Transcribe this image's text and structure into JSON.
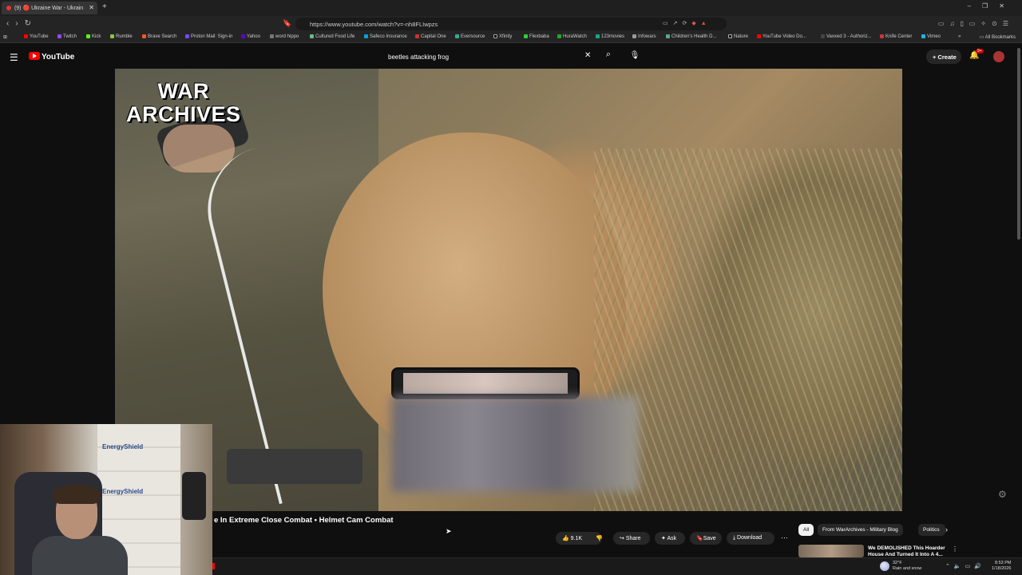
{
  "browser": {
    "tab_title": "(9) 🔴 Ukraine War - Ukrain",
    "url": "https://www.youtube.com/watch?v=-nh8FLIwpzs",
    "bookmarks": [
      "YouTube",
      "Twitch",
      "Kick",
      "Rumble",
      "Brave Search",
      "Proton Mail: Sign-in",
      "Yahoo",
      "word hippo",
      "Cultured Food Life",
      "Safeco Insurance",
      "Capital One",
      "Eversource",
      "Xfinity",
      "Flexbaba",
      "HuraWatch",
      "123movies",
      "Infowars",
      "Children's Health D...",
      "Nature",
      "YouTube Video Do...",
      "Vaxxed 3 - Authoriz...",
      "Knife Center",
      "Vimeo"
    ],
    "all_bookmarks": "All Bookmarks"
  },
  "youtube": {
    "logo": "YouTube",
    "search_query": "beetles attacking frog",
    "create_label": "Create",
    "notif_badge": "9+"
  },
  "video": {
    "watermark_line1": "WAR",
    "watermark_line2": "ARCHIVES",
    "title": "e In Extreme Close Combat • Helmet Cam Combat"
  },
  "webcam": {
    "label1": "EnergyShield",
    "label2": "EnergyShield"
  },
  "actions": {
    "likes": "9.1K",
    "share": "Share",
    "ask": "Ask",
    "save": "Save",
    "download": "Download"
  },
  "chips": [
    "All",
    "From WarArchives - Military Blog",
    "Politics"
  ],
  "recommendation": {
    "title": "We DEMOLISHED This Hoarder House And Turned It Into A 4..."
  },
  "taskbar": {
    "temperature": "32°F",
    "weather_desc": "Rain and snow",
    "time": "8:53 PM",
    "date": "1/18/2026"
  }
}
